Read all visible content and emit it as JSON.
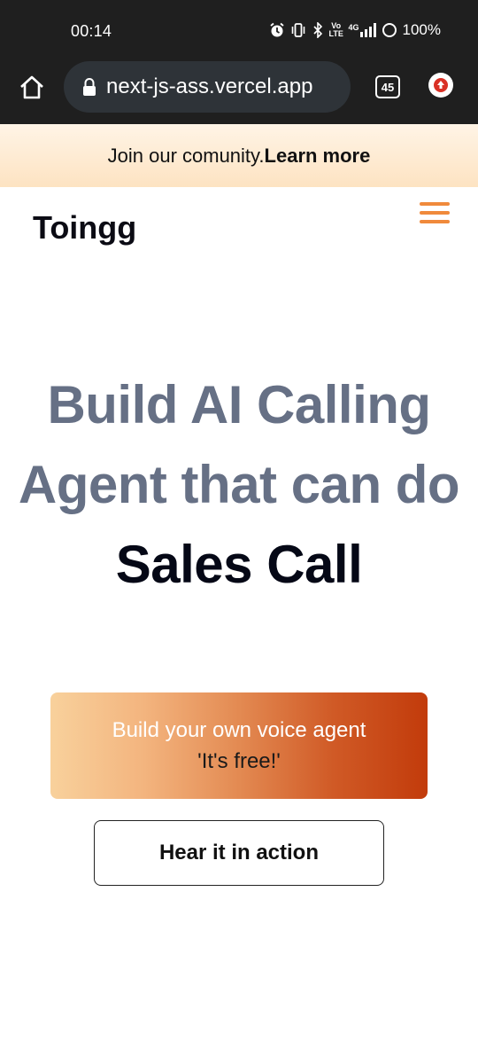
{
  "status_bar": {
    "time": "00:14",
    "network_label": "4G",
    "volte_label": "Vo LTE",
    "battery": "100%"
  },
  "browser": {
    "url": "next-js-ass.vercel.app",
    "tab_count": "45"
  },
  "announcement": {
    "text": "Join our comunity.",
    "link": "Learn more"
  },
  "header": {
    "logo": "Toingg"
  },
  "hero": {
    "line1": "Build AI Calling",
    "line2": "Agent that can do",
    "highlight": "Sales Call"
  },
  "cta": {
    "line1": "Build your own voice agent",
    "line2": "'It's free!'"
  },
  "secondary_button": {
    "label": "Hear it in action"
  },
  "colors": {
    "accent": "#f08a3c",
    "gradient_start": "#f8d19c",
    "gradient_end": "#c23b0b",
    "hero_gray": "#667085"
  },
  "icons": [
    "alarm-icon",
    "vibrate-icon",
    "bluetooth-icon",
    "volte-icon",
    "signal-icon",
    "battery-icon",
    "home-icon",
    "lock-icon",
    "tabs-icon",
    "update-icon",
    "hamburger-icon"
  ]
}
